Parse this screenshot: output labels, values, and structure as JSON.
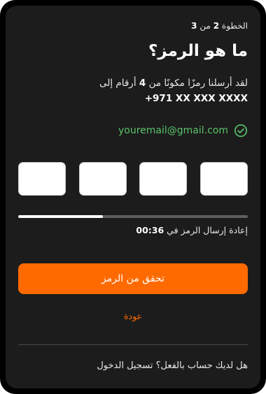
{
  "step": {
    "prefix": "الخطوة",
    "current": "2",
    "separator": "من",
    "total": "3"
  },
  "title": "ما هو الرمز؟",
  "description": {
    "line1_before": "لقد أرسلنا رمزًا مكونًا من",
    "digits": "4",
    "line1_after": "أرقام إلى",
    "phone": "+971 XX XXX XXXX"
  },
  "email": {
    "address": "youremail@gmail.com",
    "icon": "check-circle-icon"
  },
  "otp": {
    "fields": [
      "",
      "",
      "",
      ""
    ]
  },
  "progress": {
    "fraction": 0.37
  },
  "resend": {
    "label": "إعادة إرسال الرمز في",
    "time": "00:36"
  },
  "verify_button": "تحقق من الرمز",
  "back_link": "عودة",
  "login_prompt": "هل لديك حساب بالفعل؟ تسجيل الدخول",
  "colors": {
    "accent": "#ff6a00",
    "success": "#59c36a",
    "background": "#1c1c1c"
  }
}
